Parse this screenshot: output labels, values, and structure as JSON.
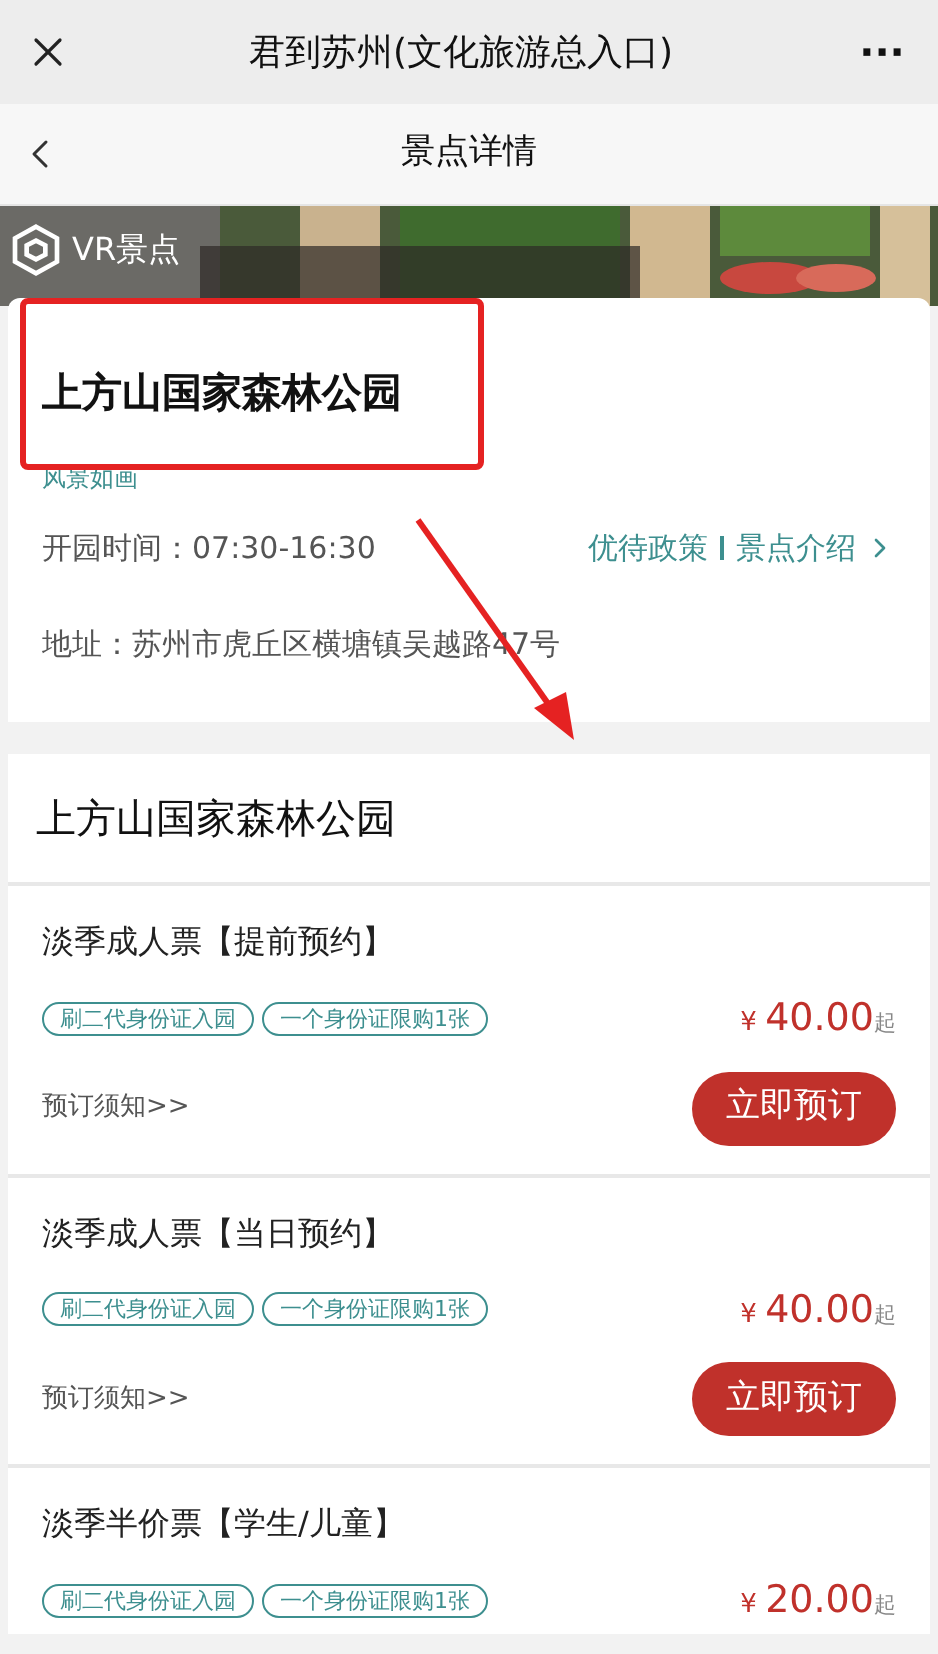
{
  "window": {
    "title": "君到苏州(文化旅游总入口)",
    "more": "···"
  },
  "nav": {
    "title": "景点详情"
  },
  "banner": {
    "vr_label": "VR景点"
  },
  "spot": {
    "name": "上方山国家森林公园",
    "tagline": "风景如画",
    "hours": "开园时间：07:30-16:30",
    "links": [
      "优待政策",
      "景点介绍"
    ],
    "address": "地址：苏州市虎丘区横塘镇吴越路47号"
  },
  "tickets_section": {
    "title": "上方山国家森林公园",
    "tickets": [
      {
        "name": "淡季成人票【提前预约】",
        "tags": [
          "刷二代身份证入园",
          "一个身份证限购1张"
        ],
        "currency": "¥",
        "price": "40.00",
        "price_suffix": "起",
        "notice": "预订须知>>",
        "button": "立即预订"
      },
      {
        "name": "淡季成人票【当日预约】",
        "tags": [
          "刷二代身份证入园",
          "一个身份证限购1张"
        ],
        "currency": "¥",
        "price": "40.00",
        "price_suffix": "起",
        "notice": "预订须知>>",
        "button": "立即预订"
      },
      {
        "name": "淡季半价票【学生/儿童】",
        "tags": [
          "刷二代身份证入园",
          "一个身份证限购1张"
        ],
        "currency": "¥",
        "price": "20.00",
        "price_suffix": "起"
      }
    ]
  }
}
